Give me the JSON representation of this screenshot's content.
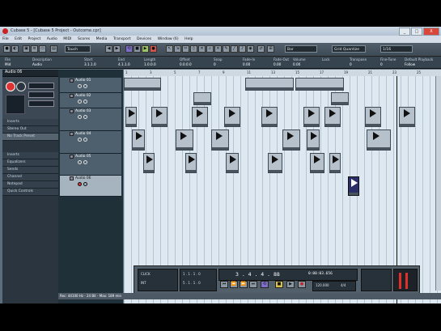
{
  "window": {
    "title": "Cubase 5 - [Cubase 5 Project - Outcome.cpr]",
    "close_label": "X",
    "minimize_label": "_",
    "maximize_label": "□"
  },
  "menu": [
    "File",
    "Edit",
    "Project",
    "Audio",
    "MIDI",
    "Scores",
    "Media",
    "Transport",
    "Devices",
    "Window (6)",
    "Help"
  ],
  "toolbar": {
    "mode_label": "Touch",
    "snap_label": "Grid Quantize",
    "quantize_label": "1/16",
    "grid_label": "Bar"
  },
  "infoline": {
    "headers": [
      "File",
      "Description",
      "Start",
      "End",
      "Length",
      "Offset",
      "Snap",
      "Fade-In",
      "Fade-Out",
      "Volume",
      "Lock",
      "Transpose",
      "Fine-Tune",
      "Default Playback"
    ],
    "values": [
      "Mid",
      "Audio",
      "3.1.1.0",
      "4.1.1.0",
      "1.0.0.0",
      "0.0.0.0",
      "0",
      "0.00",
      "0.00",
      "0.00",
      "",
      "0",
      "0",
      "Follow"
    ]
  },
  "inspector": {
    "track_name": "Audio 06",
    "sections": [
      "Inserts",
      "Stereo Out",
      "No Track Preset"
    ],
    "lower_sections": [
      "Inserts",
      "Equalizers",
      "Sends",
      "Channel",
      "Notepad",
      "Quick Controls"
    ]
  },
  "tracks": [
    "Audio 01",
    "Audio 02",
    "Audio 03",
    "Audio 04",
    "Audio 05",
    "Audio 06"
  ],
  "ruler_marks": [
    "1",
    "3",
    "5",
    "7",
    "9",
    "11",
    "13",
    "15",
    "17",
    "19",
    "21",
    "23",
    "25"
  ],
  "transport": {
    "position_primary": "3 . 4 . 4 . 88",
    "position_secondary": "0:00:03.656",
    "left_locator": "1 . 1 . 1 . 0",
    "right_locator": "5 . 1 . 1 . 0",
    "tempo": "120.000",
    "signature": "4/4",
    "click_label": "CLICK",
    "sync_label": "INT",
    "controls": [
      "⏮",
      "⏪",
      "⏩",
      "⏭",
      "⟲",
      "■",
      "▶",
      "●"
    ]
  },
  "statusbar": {
    "text": "Rec: 44100 Hz - 24 Bit - Max: 189 min"
  }
}
